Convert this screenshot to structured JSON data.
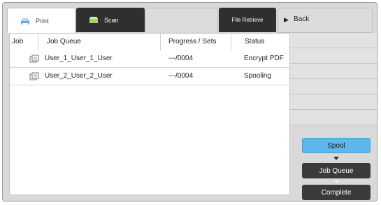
{
  "tabs": {
    "print": {
      "label": "Print",
      "icon": "printer-icon"
    },
    "scan": {
      "label": "Scan",
      "icon": "scanner-icon"
    },
    "file_retrieve": {
      "label": "File Retrieve"
    }
  },
  "back_button": {
    "label": "Back",
    "icon": "play-arrow-icon"
  },
  "table": {
    "headers": [
      "Job",
      "Job Queue",
      "Progress / Sets",
      "Status"
    ],
    "rows": [
      {
        "name": "User_1_User_1_User",
        "progress": "---/0004",
        "status": "Encrypt PDF"
      },
      {
        "name": "User_2_User_2_User",
        "progress": "---/0004",
        "status": "Spooling"
      }
    ]
  },
  "status_flow": {
    "spool": "Spool",
    "job_queue": "Job Queue",
    "complete": "Complete"
  },
  "colors": {
    "spool_active": "#5fb6ea",
    "dark_button": "#3a3a3a",
    "tab_dark": "#2f2f2f"
  }
}
